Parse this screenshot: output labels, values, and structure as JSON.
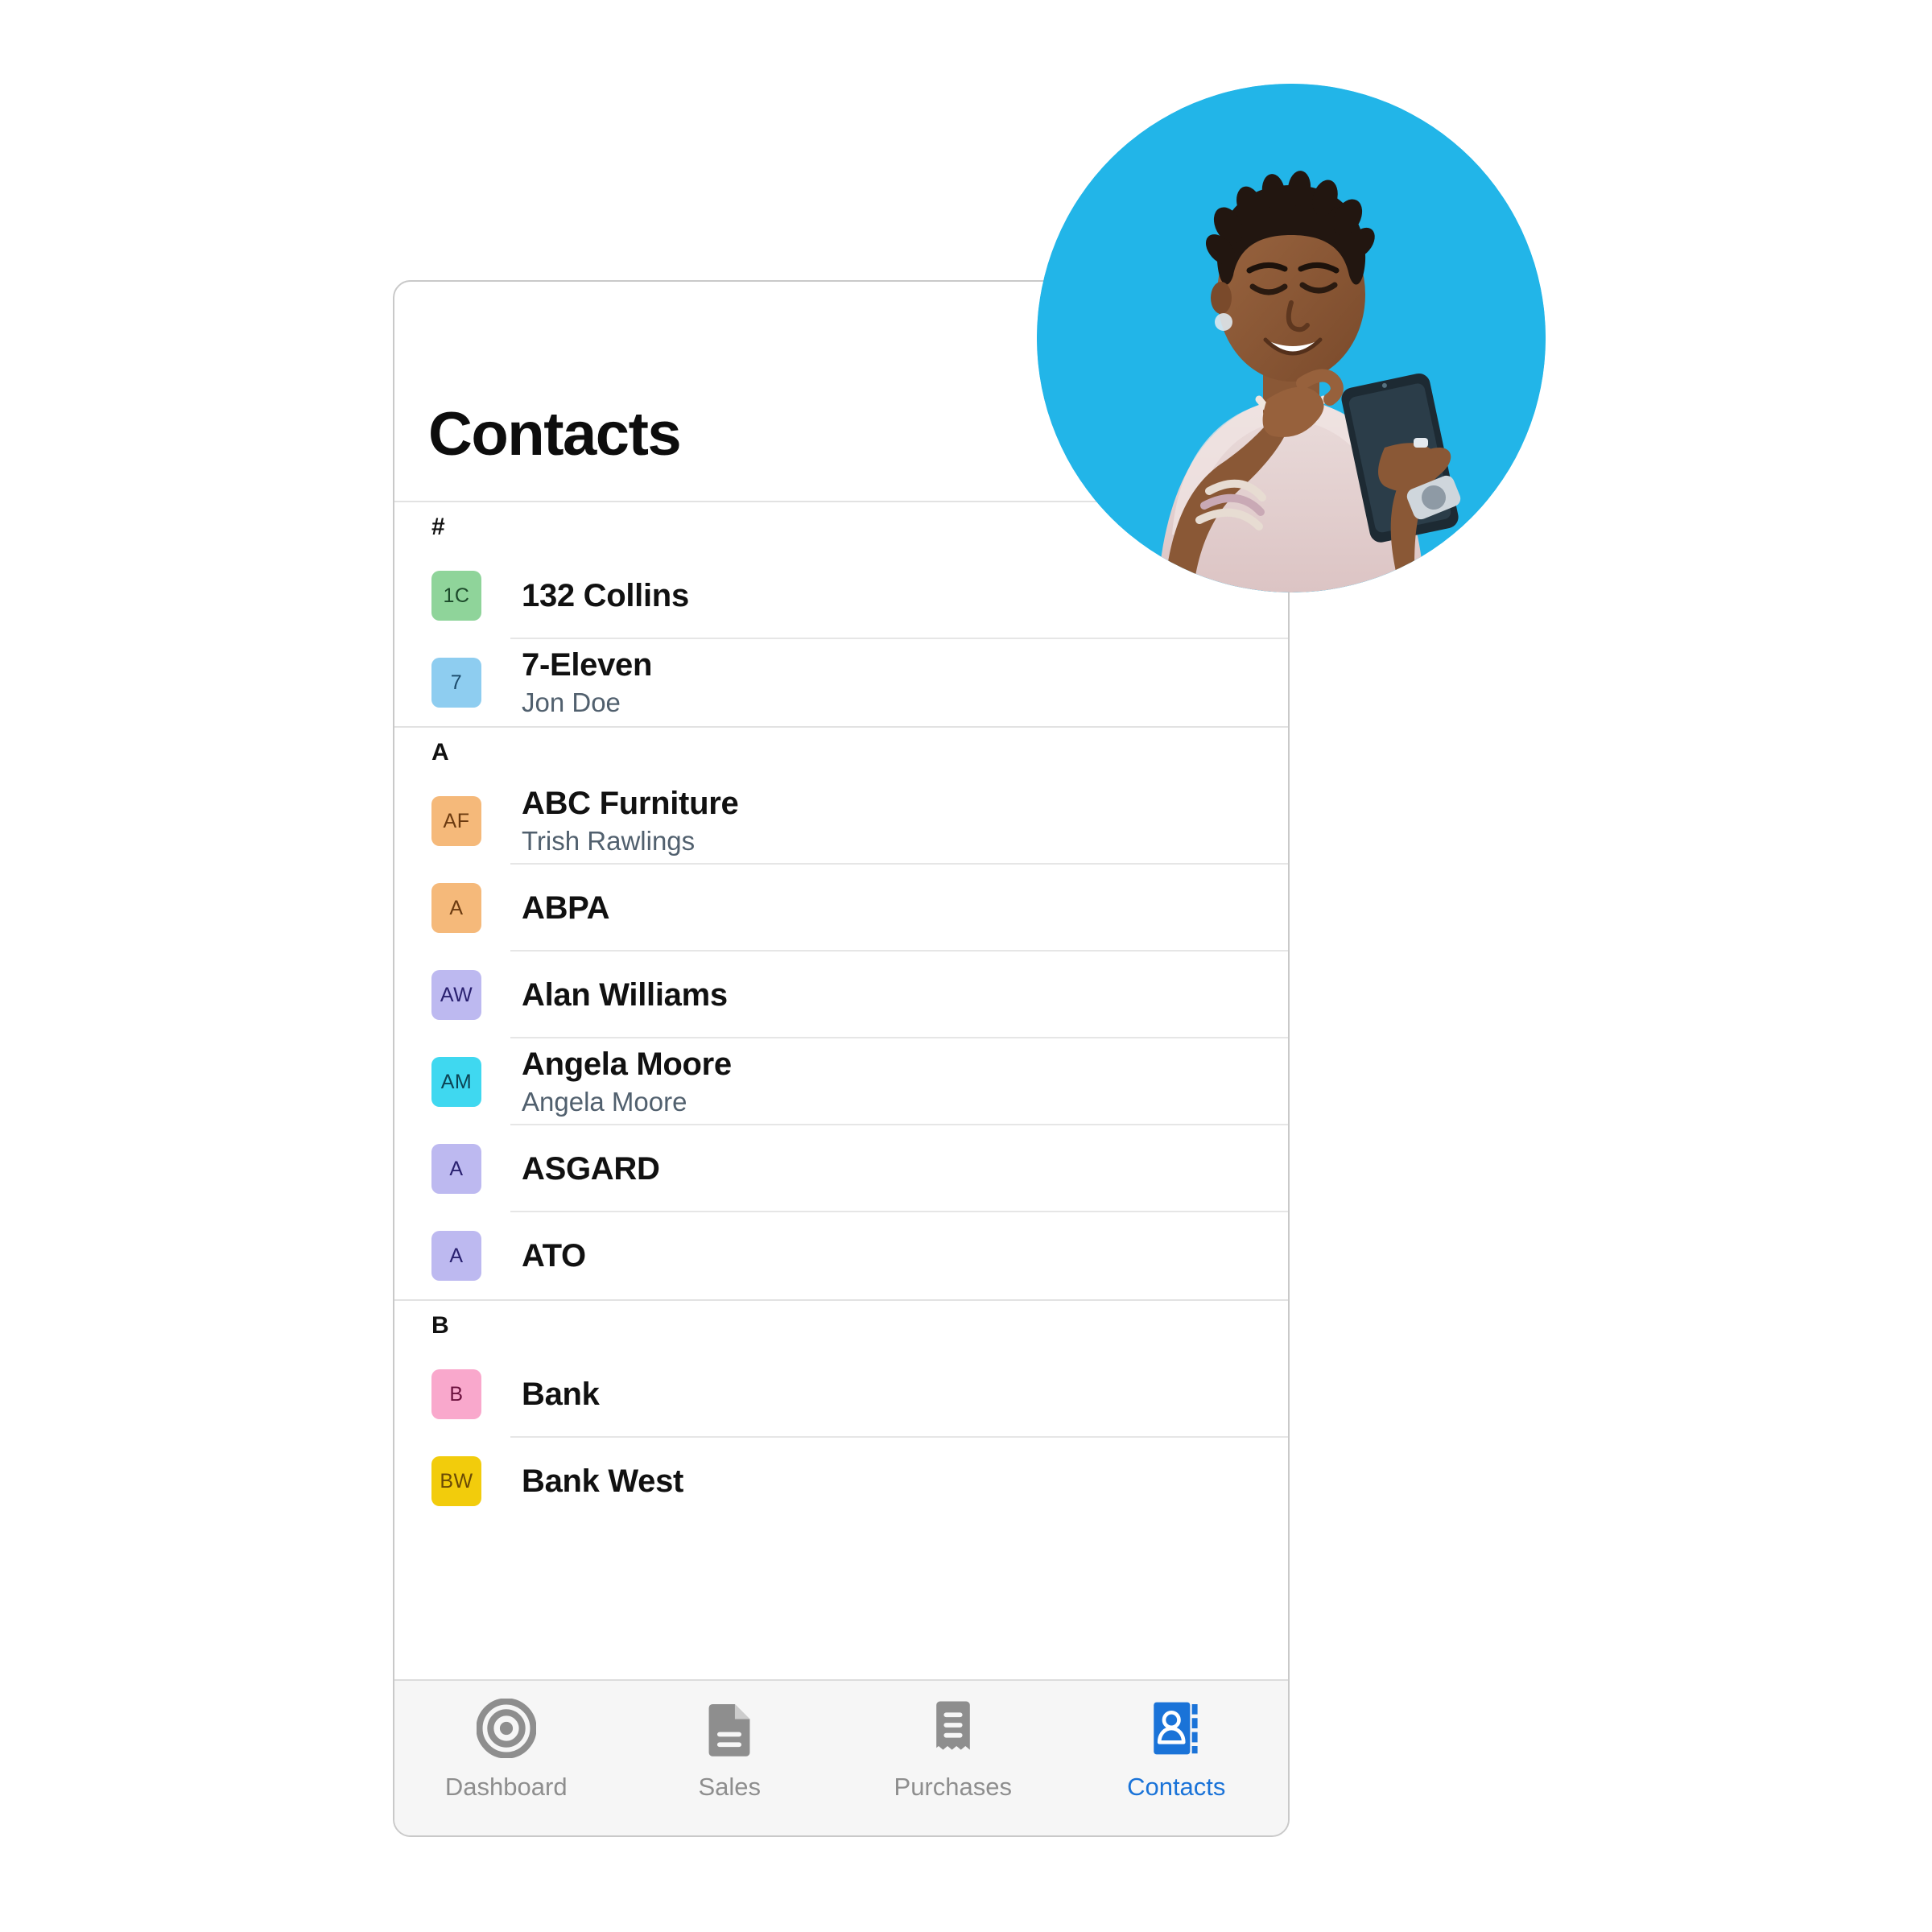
{
  "header": {
    "title": "Contacts"
  },
  "groups": [
    {
      "letter": "#",
      "contacts": [
        {
          "initials": "1C",
          "name": "132 Collins",
          "subtitle": "",
          "bg": "#8fd49a",
          "fg": "#1d4a2b"
        },
        {
          "initials": "7",
          "name": "7-Eleven",
          "subtitle": "Jon Doe",
          "bg": "#8ecdf0",
          "fg": "#1b4a6b"
        }
      ]
    },
    {
      "letter": "A",
      "contacts": [
        {
          "initials": "AF",
          "name": "ABC Furniture",
          "subtitle": "Trish Rawlings",
          "bg": "#f5b97a",
          "fg": "#6b3a10"
        },
        {
          "initials": "A",
          "name": "ABPA",
          "subtitle": "",
          "bg": "#f5b97a",
          "fg": "#6b3a10"
        },
        {
          "initials": "AW",
          "name": "Alan Williams",
          "subtitle": "",
          "bg": "#bdb9f0",
          "fg": "#2a2170"
        },
        {
          "initials": "AM",
          "name": "Angela Moore",
          "subtitle": "Angela Moore",
          "bg": "#3fd8f0",
          "fg": "#0c4455"
        },
        {
          "initials": "A",
          "name": "ASGARD",
          "subtitle": "",
          "bg": "#bdb9f0",
          "fg": "#2a2170"
        },
        {
          "initials": "A",
          "name": "ATO",
          "subtitle": "",
          "bg": "#bdb9f0",
          "fg": "#2a2170"
        }
      ]
    },
    {
      "letter": "B",
      "contacts": [
        {
          "initials": "B",
          "name": "Bank",
          "subtitle": "",
          "bg": "#f9a8cc",
          "fg": "#6d123f"
        },
        {
          "initials": "BW",
          "name": "Bank West",
          "subtitle": "",
          "bg": "#f2cc0c",
          "fg": "#6a4a06"
        }
      ]
    }
  ],
  "tabs": [
    {
      "label": "Dashboard",
      "icon": "target-icon",
      "active": false
    },
    {
      "label": "Sales",
      "icon": "document-icon",
      "active": false
    },
    {
      "label": "Purchases",
      "icon": "receipt-icon",
      "active": false
    },
    {
      "label": "Contacts",
      "icon": "contacts-book-icon",
      "active": true
    }
  ],
  "theme": {
    "accent": "#1a73d8",
    "inactive_tab": "#8e8e8e",
    "hero_background": "#22b5e8",
    "card_border": "#c9c9c9",
    "divider": "#e6e6e6"
  },
  "hero": {
    "alt": "woman-using-smartphone-photo"
  }
}
